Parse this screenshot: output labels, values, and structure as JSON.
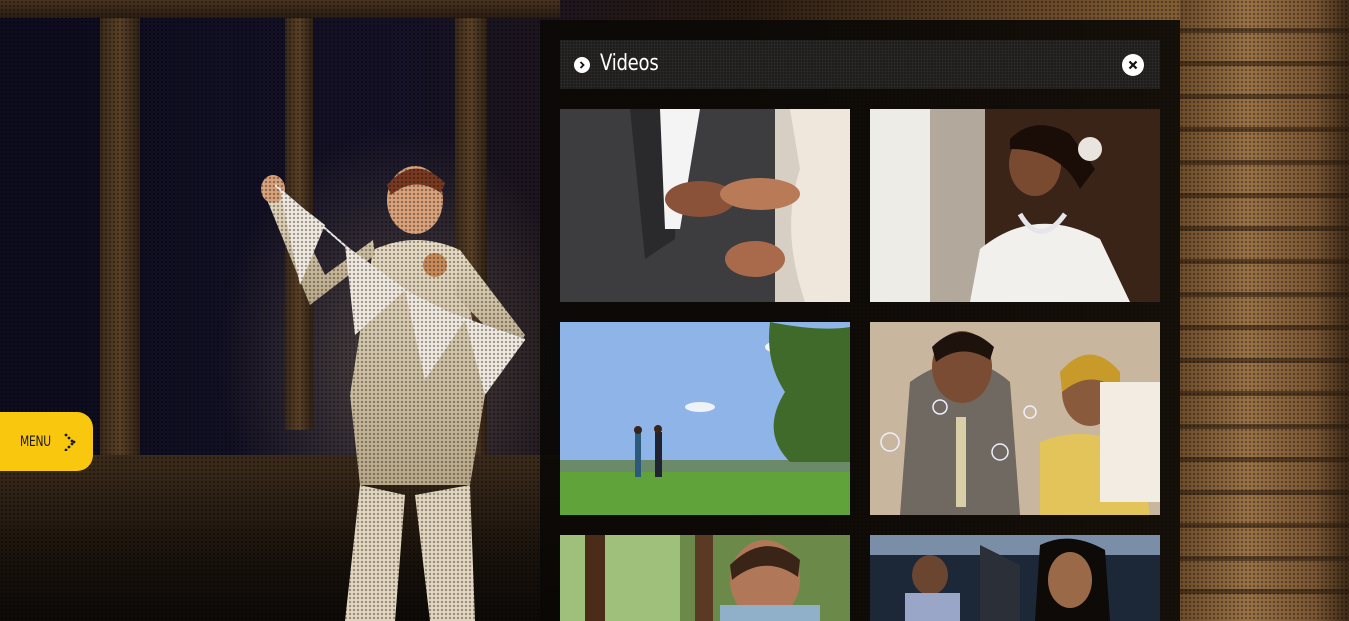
{
  "panel": {
    "title": "Videos",
    "title_icon": "chevron-right-circle-icon",
    "close_icon": "close-circle-icon"
  },
  "menu": {
    "label": "MENU",
    "icon": "dotted-chevron-right-icon",
    "color": "#f9c80e"
  },
  "videos": [
    {
      "scene": "ring-exchange-hands"
    },
    {
      "scene": "bride-at-window"
    },
    {
      "scene": "couple-walking-field"
    },
    {
      "scene": "couple-cake-bubbles"
    },
    {
      "scene": "man-garden"
    },
    {
      "scene": "couple-in-car"
    }
  ]
}
